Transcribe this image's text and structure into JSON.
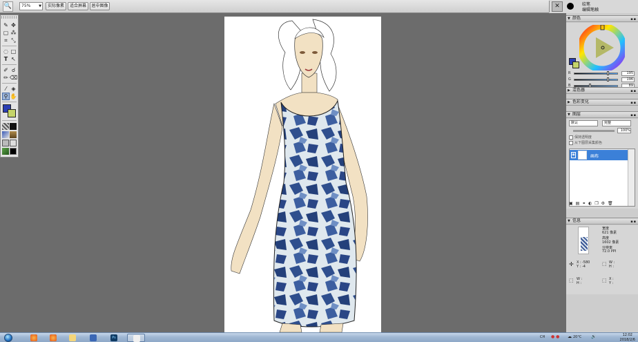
{
  "toolbar": {
    "zoom_value": "75%",
    "btn_actual_pixels": "实际像素",
    "btn_fit_screen": "适合屏幕",
    "btn_center_image": "居中图像"
  },
  "brush_options": {
    "label1": "绘笔",
    "label2": "编辑笔触"
  },
  "panels": {
    "color": {
      "title": "颜色",
      "fg_color": "#2b3fb3",
      "bg_color": "#c5d46a",
      "r_label": "R",
      "g_label": "G",
      "b_label": "B",
      "r": "195",
      "g": "196",
      "b": "89"
    },
    "mixer": {
      "title": "混色器"
    },
    "color_change": {
      "title": "色彩变化"
    },
    "layers": {
      "title": "图层",
      "blend_mode": "默认",
      "lock_mode": "完整",
      "opacity": "100%",
      "option1": "保持透明度",
      "option2": "从下图层采集颜色",
      "layer_name": "画布"
    },
    "info": {
      "title": "信息",
      "width_label": "宽度",
      "width_value": "621 像素",
      "height_label": "高度",
      "height_value": "1602 像素",
      "res_label": "分辨率",
      "res_value": "72.0 PPI",
      "x_label": "X :",
      "x_value": "-580",
      "y_label": "Y :",
      "y_value": "-4",
      "w_label": "W :",
      "h_label": "H :",
      "sx_label": "X :",
      "sy_label": "Y :"
    }
  },
  "taskbar": {
    "tray_label": "CH",
    "temp": "20°C",
    "time": "12:02",
    "date": "2018/2/6"
  },
  "icons": [
    "search-icon",
    "brush-icon",
    "eyedropper-icon",
    "hand-icon",
    "zoom-icon",
    "text-icon",
    "lasso-icon",
    "marquee-icon",
    "crop-icon",
    "move-icon"
  ]
}
